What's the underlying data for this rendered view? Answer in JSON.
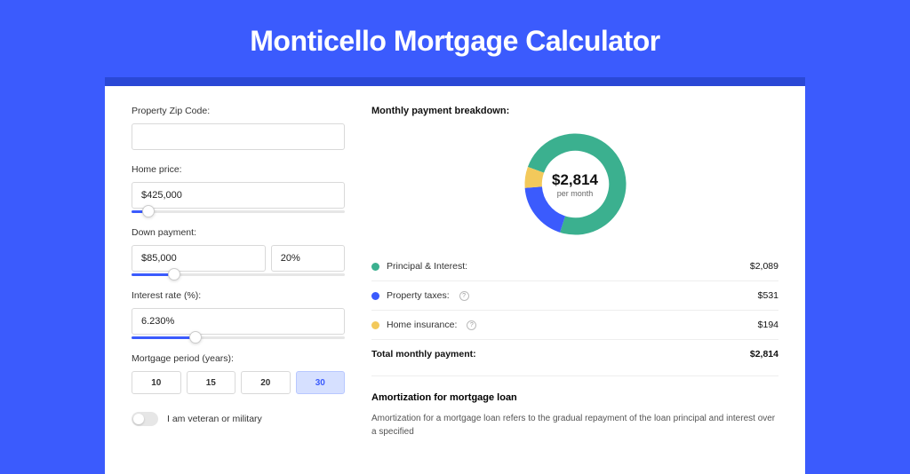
{
  "hero": {
    "title": "Monticello Mortgage Calculator"
  },
  "form": {
    "zip": {
      "label": "Property Zip Code:",
      "value": ""
    },
    "price": {
      "label": "Home price:",
      "value": "$425,000",
      "slider_pct": 8
    },
    "down": {
      "label": "Down payment:",
      "value": "$85,000",
      "pct": "20%",
      "slider_pct": 20
    },
    "rate": {
      "label": "Interest rate (%):",
      "value": "6.230%",
      "slider_pct": 30
    },
    "term": {
      "label": "Mortgage period (years):",
      "options": [
        "10",
        "15",
        "20",
        "30"
      ],
      "active": "30"
    },
    "veteran": {
      "label": "I am veteran or military",
      "on": false
    }
  },
  "breakdown": {
    "title": "Monthly payment breakdown:",
    "center_amount": "$2,814",
    "center_sub": "per month",
    "rows": [
      {
        "color": "#3bb08f",
        "label": "Principal & Interest:",
        "value": "$2,089",
        "help": false
      },
      {
        "color": "#3b5bfd",
        "label": "Property taxes:",
        "value": "$531",
        "help": true
      },
      {
        "color": "#f3c95b",
        "label": "Home insurance:",
        "value": "$194",
        "help": true
      }
    ],
    "total_label": "Total monthly payment:",
    "total_value": "$2,814"
  },
  "chart_data": {
    "type": "pie",
    "title": "Monthly payment breakdown:",
    "series": [
      {
        "name": "Principal & Interest",
        "value": 2089,
        "color": "#3bb08f"
      },
      {
        "name": "Property taxes",
        "value": 531,
        "color": "#3b5bfd"
      },
      {
        "name": "Home insurance",
        "value": 194,
        "color": "#f3c95b"
      }
    ],
    "total": 2814,
    "donut_inner_radius_pct": 62
  },
  "amortization": {
    "title": "Amortization for mortgage loan",
    "body": "Amortization for a mortgage loan refers to the gradual repayment of the loan principal and interest over a specified"
  }
}
